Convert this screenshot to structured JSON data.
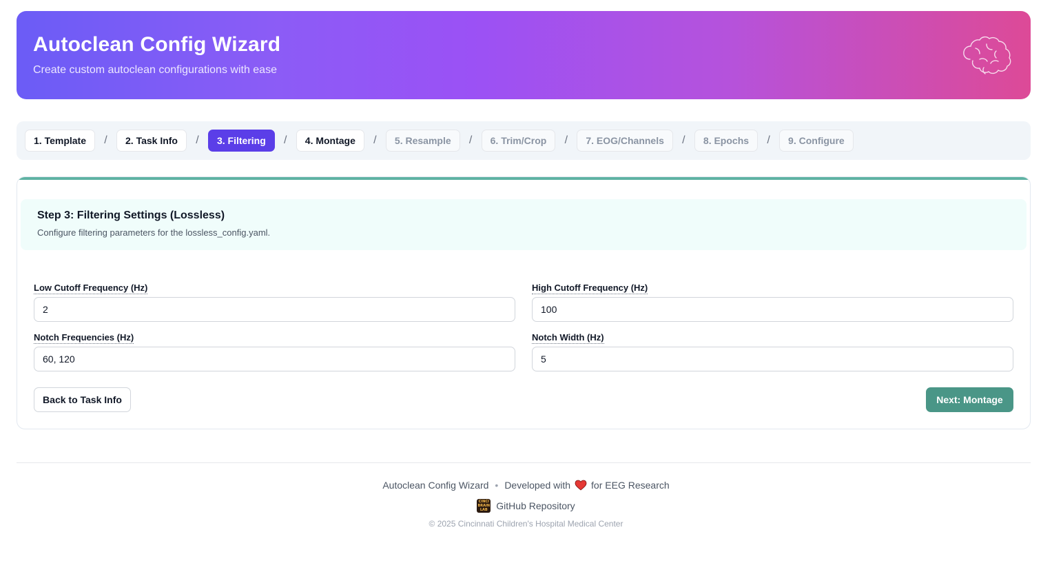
{
  "header": {
    "title": "Autoclean Config Wizard",
    "subtitle": "Create custom autoclean configurations with ease",
    "icon": "brain-icon"
  },
  "stepper": {
    "separator": "/",
    "steps": [
      {
        "label": "1. Template",
        "state": "done"
      },
      {
        "label": "2. Task Info",
        "state": "done"
      },
      {
        "label": "3. Filtering",
        "state": "active"
      },
      {
        "label": "4. Montage",
        "state": "available"
      },
      {
        "label": "5. Resample",
        "state": "disabled"
      },
      {
        "label": "6. Trim/Crop",
        "state": "disabled"
      },
      {
        "label": "7. EOG/Channels",
        "state": "disabled"
      },
      {
        "label": "8. Epochs",
        "state": "disabled"
      },
      {
        "label": "9. Configure",
        "state": "disabled"
      }
    ]
  },
  "card": {
    "title": "Step 3: Filtering Settings (Lossless)",
    "description": "Configure filtering parameters for the lossless_config.yaml.",
    "fields": {
      "low_cutoff": {
        "label": "Low Cutoff Frequency (Hz)",
        "value": "2"
      },
      "high_cutoff": {
        "label": "High Cutoff Frequency (Hz)",
        "value": "100"
      },
      "notch_freqs": {
        "label": "Notch Frequencies (Hz)",
        "value": "60, 120"
      },
      "notch_width": {
        "label": "Notch Width (Hz)",
        "value": "5"
      }
    },
    "back_label": "Back to Task Info",
    "next_label": "Next: Montage"
  },
  "footer": {
    "app_name": "Autoclean Config Wizard",
    "bullet": "•",
    "developed_with": "Developed with",
    "for_text": "for EEG Research",
    "lab_logo_text": "CINCI BRAIN LAB",
    "github_label": "GitHub Repository",
    "copyright": "© 2025 Cincinnati Children's Hospital Medical Center"
  },
  "colors": {
    "accent": "#5b3ee8",
    "teal": "#4a9687",
    "gradient_start": "#6b5cf6",
    "gradient_end": "#dd4a97"
  }
}
